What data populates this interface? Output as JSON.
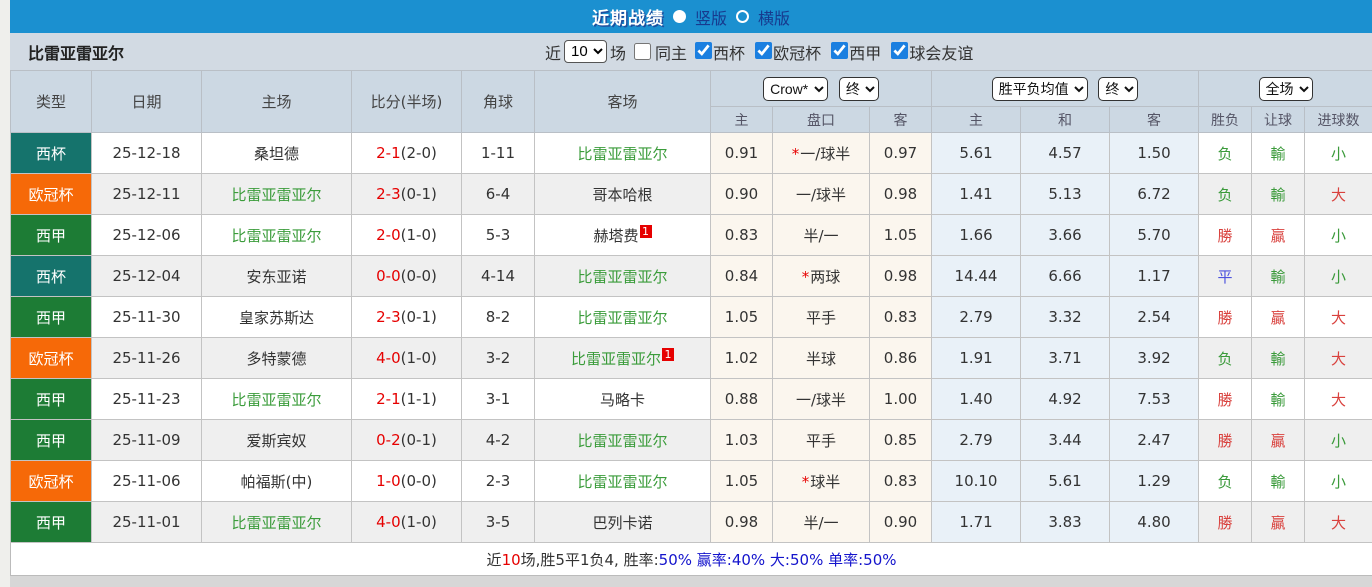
{
  "topbar": {
    "title": "近期战绩",
    "radio_vertical": "竖版",
    "radio_horizontal": "横版"
  },
  "filter": {
    "team": "比雷亚雷亚尔",
    "near_label": "近",
    "count": "10",
    "games_label": "场",
    "same_home_label": "同主",
    "leagues": [
      {
        "label": "西杯",
        "checked": true
      },
      {
        "label": "欧冠杯",
        "checked": true
      },
      {
        "label": "西甲",
        "checked": true
      },
      {
        "label": "球会友谊",
        "checked": true
      }
    ]
  },
  "table": {
    "headers": {
      "type": "类型",
      "date": "日期",
      "home": "主场",
      "score": "比分(半场)",
      "corner": "角球",
      "away": "客场",
      "odds_host": "主",
      "odds_handicap": "盘口",
      "odds_guest": "客",
      "avg_host": "主",
      "avg_draw": "和",
      "avg_guest": "客",
      "wdl": "胜负",
      "handicap_result": "让球",
      "goals": "进球数"
    },
    "selects": {
      "company": "Crow*",
      "company_state": "终",
      "avg": "胜平负均值",
      "avg_state": "终",
      "period": "全场"
    },
    "type_colors": {
      "西杯": "#15736c",
      "欧冠杯": "#f66908",
      "西甲": "#1d7c35"
    },
    "result_colors": {
      "r": "#d9413d",
      "g": "#3a9a3a",
      "b": "#4c52dd"
    },
    "rows": [
      {
        "type": "西杯",
        "date": "25-12-18",
        "home": "桑坦德",
        "home_self": false,
        "home_sup": "",
        "score_ft": "2-1",
        "score_ht": "(2-0)",
        "corner": "1-11",
        "away": "比雷亚雷亚尔",
        "away_self": true,
        "away_sup": "",
        "o_home": "0.91",
        "star": true,
        "handicap": "一/球半",
        "o_away": "0.97",
        "a_home": "5.61",
        "a_draw": "4.57",
        "a_away": "1.50",
        "wdl": "负",
        "wdl_c": "g",
        "let": "輸",
        "let_c": "g",
        "goal": "小",
        "goal_c": "g"
      },
      {
        "type": "欧冠杯",
        "date": "25-12-11",
        "home": "比雷亚雷亚尔",
        "home_self": true,
        "home_sup": "",
        "score_ft": "2-3",
        "score_ht": "(0-1)",
        "corner": "6-4",
        "away": "哥本哈根",
        "away_self": false,
        "away_sup": "",
        "o_home": "0.90",
        "star": false,
        "handicap": "一/球半",
        "o_away": "0.98",
        "a_home": "1.41",
        "a_draw": "5.13",
        "a_away": "6.72",
        "wdl": "负",
        "wdl_c": "g",
        "let": "輸",
        "let_c": "g",
        "goal": "大",
        "goal_c": "r"
      },
      {
        "type": "西甲",
        "date": "25-12-06",
        "home": "比雷亚雷亚尔",
        "home_self": true,
        "home_sup": "",
        "score_ft": "2-0",
        "score_ht": "(1-0)",
        "corner": "5-3",
        "away": "赫塔费",
        "away_self": false,
        "away_sup": "1",
        "o_home": "0.83",
        "star": false,
        "handicap": "半/一",
        "o_away": "1.05",
        "a_home": "1.66",
        "a_draw": "3.66",
        "a_away": "5.70",
        "wdl": "勝",
        "wdl_c": "r",
        "let": "贏",
        "let_c": "r",
        "goal": "小",
        "goal_c": "g"
      },
      {
        "type": "西杯",
        "date": "25-12-04",
        "home": "安东亚诺",
        "home_self": false,
        "home_sup": "",
        "score_ft": "0-0",
        "score_ht": "(0-0)",
        "corner": "4-14",
        "away": "比雷亚雷亚尔",
        "away_self": true,
        "away_sup": "",
        "o_home": "0.84",
        "star": true,
        "handicap": "两球",
        "o_away": "0.98",
        "a_home": "14.44",
        "a_draw": "6.66",
        "a_away": "1.17",
        "wdl": "平",
        "wdl_c": "b",
        "let": "輸",
        "let_c": "g",
        "goal": "小",
        "goal_c": "g"
      },
      {
        "type": "西甲",
        "date": "25-11-30",
        "home": "皇家苏斯达",
        "home_self": false,
        "home_sup": "",
        "score_ft": "2-3",
        "score_ht": "(0-1)",
        "corner": "8-2",
        "away": "比雷亚雷亚尔",
        "away_self": true,
        "away_sup": "",
        "o_home": "1.05",
        "star": false,
        "handicap": "平手",
        "o_away": "0.83",
        "a_home": "2.79",
        "a_draw": "3.32",
        "a_away": "2.54",
        "wdl": "勝",
        "wdl_c": "r",
        "let": "贏",
        "let_c": "r",
        "goal": "大",
        "goal_c": "r"
      },
      {
        "type": "欧冠杯",
        "date": "25-11-26",
        "home": "多特蒙德",
        "home_self": false,
        "home_sup": "",
        "score_ft": "4-0",
        "score_ht": "(1-0)",
        "corner": "3-2",
        "away": "比雷亚雷亚尔",
        "away_self": true,
        "away_sup": "1",
        "o_home": "1.02",
        "star": false,
        "handicap": "半球",
        "o_away": "0.86",
        "a_home": "1.91",
        "a_draw": "3.71",
        "a_away": "3.92",
        "wdl": "负",
        "wdl_c": "g",
        "let": "輸",
        "let_c": "g",
        "goal": "大",
        "goal_c": "r"
      },
      {
        "type": "西甲",
        "date": "25-11-23",
        "home": "比雷亚雷亚尔",
        "home_self": true,
        "home_sup": "",
        "score_ft": "2-1",
        "score_ht": "(1-1)",
        "corner": "3-1",
        "away": "马略卡",
        "away_self": false,
        "away_sup": "",
        "o_home": "0.88",
        "star": false,
        "handicap": "一/球半",
        "o_away": "1.00",
        "a_home": "1.40",
        "a_draw": "4.92",
        "a_away": "7.53",
        "wdl": "勝",
        "wdl_c": "r",
        "let": "輸",
        "let_c": "g",
        "goal": "大",
        "goal_c": "r"
      },
      {
        "type": "西甲",
        "date": "25-11-09",
        "home": "爱斯宾奴",
        "home_self": false,
        "home_sup": "",
        "score_ft": "0-2",
        "score_ht": "(0-1)",
        "corner": "4-2",
        "away": "比雷亚雷亚尔",
        "away_self": true,
        "away_sup": "",
        "o_home": "1.03",
        "star": false,
        "handicap": "平手",
        "o_away": "0.85",
        "a_home": "2.79",
        "a_draw": "3.44",
        "a_away": "2.47",
        "wdl": "勝",
        "wdl_c": "r",
        "let": "贏",
        "let_c": "r",
        "goal": "小",
        "goal_c": "g"
      },
      {
        "type": "欧冠杯",
        "date": "25-11-06",
        "home": "帕福斯(中)",
        "home_self": false,
        "home_sup": "",
        "score_ft": "1-0",
        "score_ht": "(0-0)",
        "corner": "2-3",
        "away": "比雷亚雷亚尔",
        "away_self": true,
        "away_sup": "",
        "o_home": "1.05",
        "star": true,
        "handicap": "球半",
        "o_away": "0.83",
        "a_home": "10.10",
        "a_draw": "5.61",
        "a_away": "1.29",
        "wdl": "负",
        "wdl_c": "g",
        "let": "輸",
        "let_c": "g",
        "goal": "小",
        "goal_c": "g"
      },
      {
        "type": "西甲",
        "date": "25-11-01",
        "home": "比雷亚雷亚尔",
        "home_self": true,
        "home_sup": "",
        "score_ft": "4-0",
        "score_ht": "(1-0)",
        "corner": "3-5",
        "away": "巴列卡诺",
        "away_self": false,
        "away_sup": "",
        "o_home": "0.98",
        "star": false,
        "handicap": "半/一",
        "o_away": "0.90",
        "a_home": "1.71",
        "a_draw": "3.83",
        "a_away": "4.80",
        "wdl": "勝",
        "wdl_c": "r",
        "let": "贏",
        "let_c": "r",
        "goal": "大",
        "goal_c": "r"
      }
    ]
  },
  "footer": {
    "prefix": "近",
    "count": "10",
    "middle": "场,胜5平1负4, ",
    "win_rate_label": "胜率:",
    "win_rate_value": "50%",
    "rest": " 赢率:40% 大:50% 单率:50%"
  }
}
